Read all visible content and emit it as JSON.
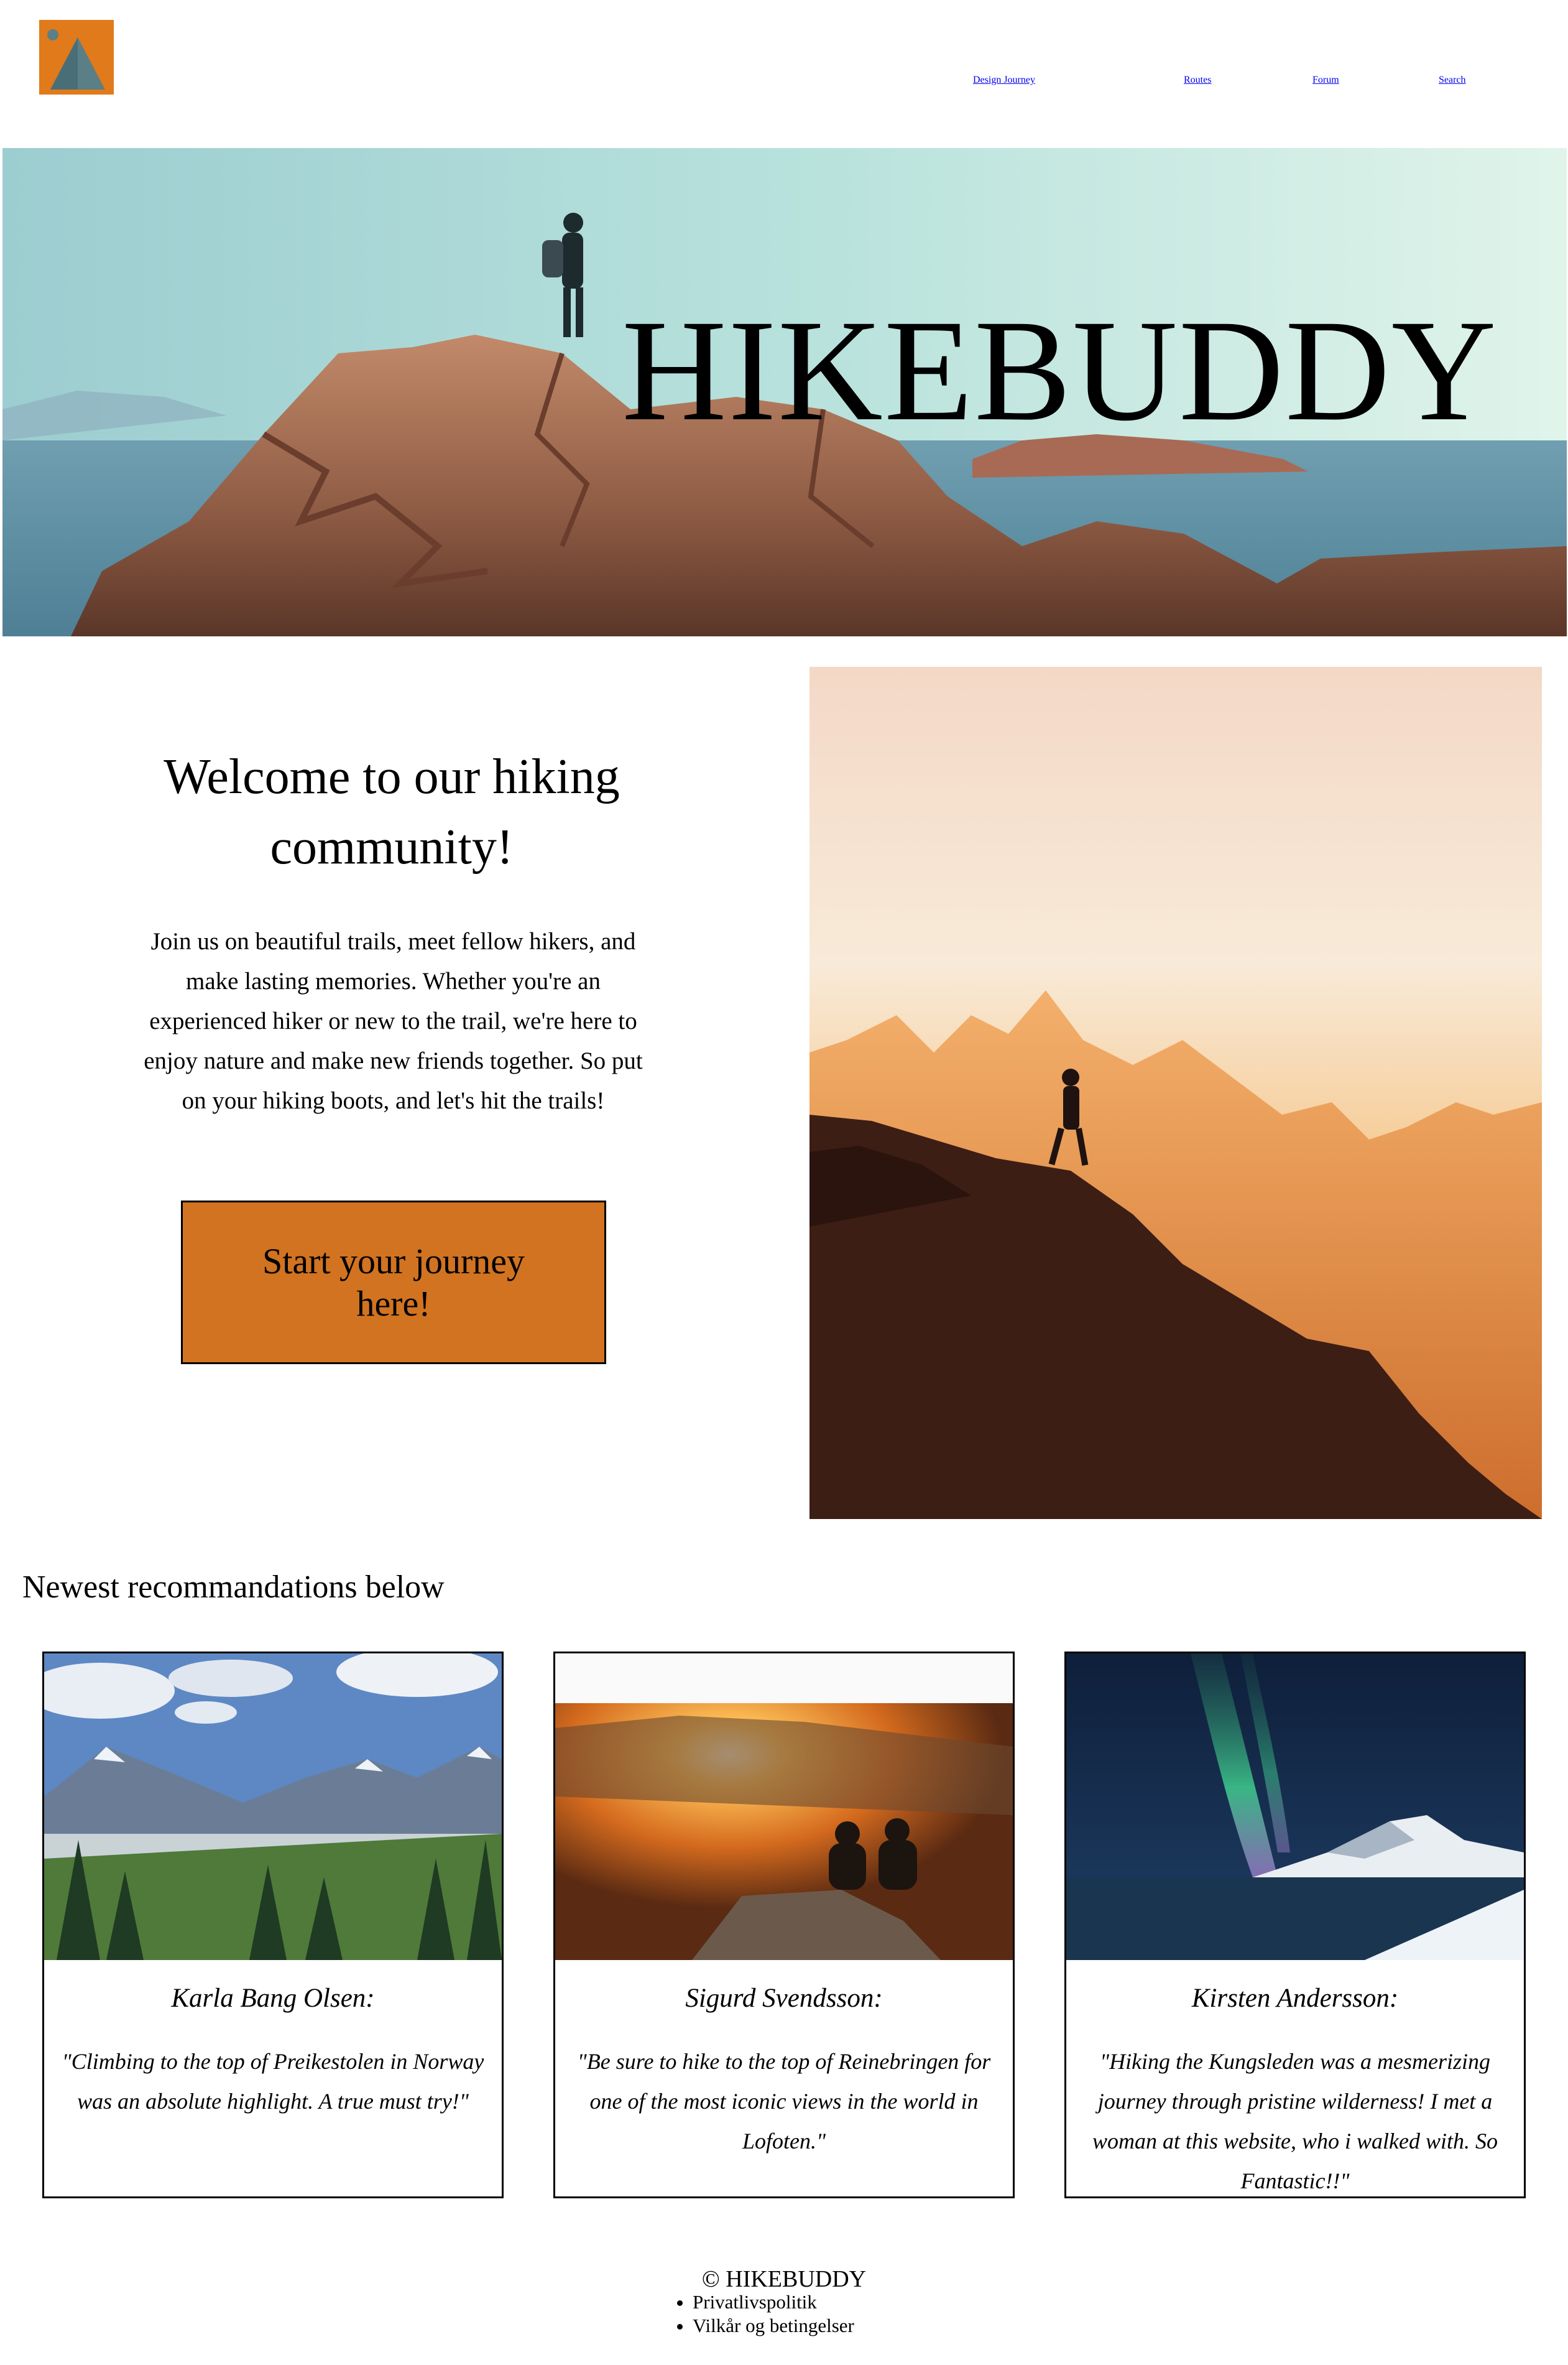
{
  "header": {
    "logo_icon": "mountain-logo-icon",
    "nav": [
      {
        "label": "Design Journey"
      },
      {
        "label": "Routes"
      },
      {
        "label": "Forum"
      },
      {
        "label": "Search"
      }
    ]
  },
  "hero": {
    "title": "HIKEBUDDY",
    "image_icon": "hiker-on-rocks-photo"
  },
  "welcome": {
    "title": "Welcome to our hiking community!",
    "text": "Join us on beautiful trails, meet fellow hikers, and make lasting memories. Whether you're an experienced hiker or new to the trail, we're here to enjoy nature and make new friends together. So put on your hiking boots, and let's hit the trails!",
    "cta_label": "Start your journey here!",
    "image_icon": "hiker-sunset-ridge-photo"
  },
  "recommendations": {
    "title": "Newest recommandations below",
    "cards": [
      {
        "author": "Karla Bang Olsen:",
        "quote": "\"Climbing to the top of Preikestolen in Norway was an absolute highlight. A true must try!\"",
        "image_icon": "mountain-valley-photo"
      },
      {
        "author": "Sigurd Svendsson:",
        "quote": "\"Be sure to hike to the top of Reinebringen for one of the most iconic views in the world in Lofoten.\"",
        "image_icon": "sunset-hikers-photo"
      },
      {
        "author": "Kirsten Andersson:",
        "quote": "\"Hiking the Kungsleden was a mesmerizing journey through pristine wilderness! I met a woman at this website, who i walked with. So Fantastic!!\"",
        "image_icon": "northern-lights-photo"
      }
    ]
  },
  "footer": {
    "copyright": "© HIKEBUDDY",
    "links": [
      {
        "label": "Privatlivspolitik"
      },
      {
        "label": "Vilkår og betingelser"
      }
    ]
  },
  "colors": {
    "cta_background": "#d17320",
    "logo_orange": "#e07a1b",
    "logo_teal": "#4a6e78"
  }
}
